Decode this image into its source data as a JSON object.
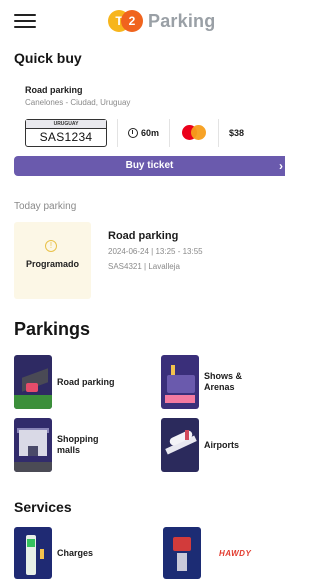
{
  "header": {
    "logo_badge_left": "T",
    "logo_badge_right": "2",
    "logo_text": "Parking"
  },
  "quick_buy": {
    "title": "Quick buy",
    "card_title": "Road parking",
    "card_subtitle": "Canelones - Ciudad, Uruguay",
    "plate_country": "URUGUAY",
    "plate_number": "SAS1234",
    "duration": "60m",
    "price": "$38",
    "buy_label": "Buy ticket",
    "buy_arrow": "›"
  },
  "today_parking": {
    "title": "Today parking",
    "status": "Programado",
    "name": "Road parking",
    "time": "2024-06-24 | 13:25 - 13:55",
    "plate_location": "SAS4321 | Lavalleja"
  },
  "parkings": {
    "title": "Parkings",
    "items": [
      {
        "label": "Road parking"
      },
      {
        "label": "Shows & Arenas"
      },
      {
        "label": "Shopping malls"
      },
      {
        "label": "Airports"
      }
    ]
  },
  "services": {
    "title": "Services",
    "items": [
      {
        "label": "Charges"
      },
      {
        "label": "HAWDY"
      }
    ]
  },
  "colors": {
    "accent": "#6a5aad",
    "logo_yellow": "#f7b51c",
    "logo_orange": "#f0641e",
    "today_tile_bg": "#fcf7e6"
  },
  "icons": [
    "menu-icon",
    "clock-icon",
    "mastercard-icon",
    "alert-icon"
  ]
}
